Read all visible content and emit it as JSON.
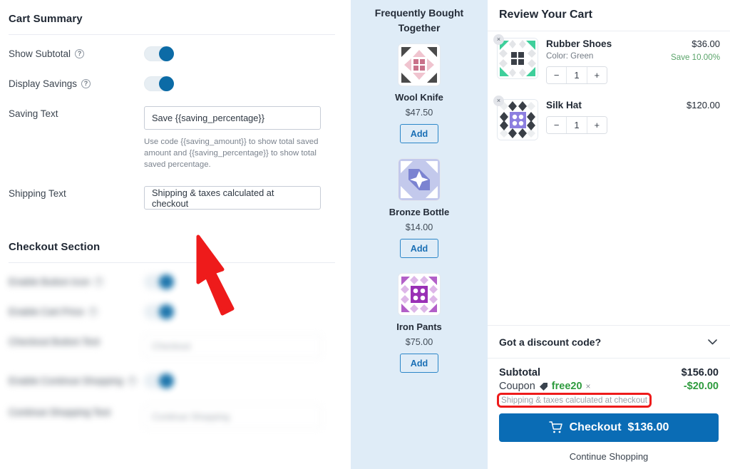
{
  "settings": {
    "cart_summary": {
      "title": "Cart Summary",
      "show_subtotal": {
        "label": "Show Subtotal",
        "help": "?",
        "value": "on"
      },
      "display_savings": {
        "label": "Display Savings",
        "help": "?",
        "value": "on"
      },
      "saving_text": {
        "label": "Saving Text",
        "value": "Save {{saving_percentage}}",
        "hint": "Use code {{saving_amount}} to show total saved amount and {{saving_percentage}} to show total saved percentage."
      },
      "shipping_text": {
        "label": "Shipping Text",
        "value": "Shipping & taxes calculated at checkout"
      }
    },
    "checkout_section": {
      "title": "Checkout Section",
      "rows": [
        {
          "label": "Enable Button Icon",
          "type": "toggle",
          "value": "on"
        },
        {
          "label": "Enable Cart Price",
          "type": "toggle",
          "value": "on"
        },
        {
          "label": "Checkout Button Text",
          "type": "text",
          "value": "Checkout"
        },
        {
          "label": "Enable Continue Shopping",
          "type": "toggle",
          "value": "on"
        },
        {
          "label": "Continue Shopping Text",
          "type": "text",
          "value": "Continue Shopping"
        }
      ]
    }
  },
  "fbt": {
    "title": "Frequently Bought Together",
    "add_label": "Add",
    "products": [
      {
        "name": "Wool Knife",
        "price": "$47.50",
        "swatch": "#c9718a",
        "accent": "#4a4a4a",
        "light": "#f0c4cf"
      },
      {
        "name": "Bronze Bottle",
        "price": "$14.00",
        "swatch": "#7b83d1",
        "accent": "#5b66c4",
        "light": "#c3c9ec"
      },
      {
        "name": "Iron Pants",
        "price": "$75.00",
        "swatch": "#9930b5",
        "accent": "#b25fc8",
        "light": "#ddb6e8"
      }
    ]
  },
  "cart": {
    "header": "Review Your Cart",
    "remove_glyph": "×",
    "items": [
      {
        "name": "Rubber Shoes",
        "variant": "Color: Green",
        "price": "$36.00",
        "save": "Save 10.00%",
        "qty": "1",
        "minus": "−",
        "plus": "+",
        "swatch": "#3ecf9b",
        "accent": "#3a3f47",
        "light": "#e3e5e8"
      },
      {
        "name": "Silk Hat",
        "variant": "",
        "price": "$120.00",
        "save": "",
        "qty": "1",
        "minus": "−",
        "plus": "+",
        "swatch": "#8d7fe0",
        "accent": "#3a3f47",
        "light": "#e9eaec"
      }
    ],
    "discount": {
      "label": "Got a discount code?",
      "chevron": "chevron-down"
    },
    "totals": {
      "subtotal_label": "Subtotal",
      "subtotal_value": "$156.00",
      "coupon_label": "Coupon",
      "coupon_code": "free20",
      "coupon_remove": "×",
      "coupon_value": "-$20.00",
      "shipping_note": "Shipping & taxes calculated at checkout"
    },
    "checkout_button": {
      "label": "Checkout",
      "amount": "$136.00",
      "icon": "cart-icon"
    },
    "continue_link": "Continue Shopping"
  },
  "annotation": {
    "arrow_color": "#ee1b1b",
    "highlight_color": "#ee1b1b"
  },
  "colors": {
    "accent_blue": "#0a6cb5",
    "toggle_blue": "#0c6ba6",
    "fbt_background": "#dfecf7",
    "savings_green": "#5aa46a",
    "coupon_green": "#2e9b3e"
  }
}
